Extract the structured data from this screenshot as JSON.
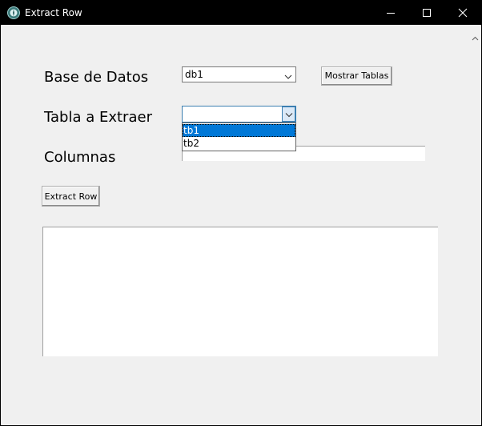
{
  "window": {
    "title": "Extract Row",
    "app_icon": "python-feather-icon",
    "controls": {
      "minimize_icon": "minimize-icon",
      "maximize_icon": "maximize-icon",
      "close_icon": "close-icon"
    }
  },
  "form": {
    "database_label": "Base de Datos",
    "database_selected": "db1",
    "show_tables_button": "Mostrar Tablas",
    "table_label": "Tabla a Extraer",
    "table_selected": "",
    "table_options": [
      "tb1",
      "tb2"
    ],
    "table_highlighted": "tb1",
    "columns_label": "Columnas",
    "columns_value": "",
    "extract_button": "Extract Row",
    "output_text": ""
  },
  "colors": {
    "titlebar_bg": "#000000",
    "client_bg": "#f0f0f0",
    "selection_bg": "#0078d7"
  }
}
